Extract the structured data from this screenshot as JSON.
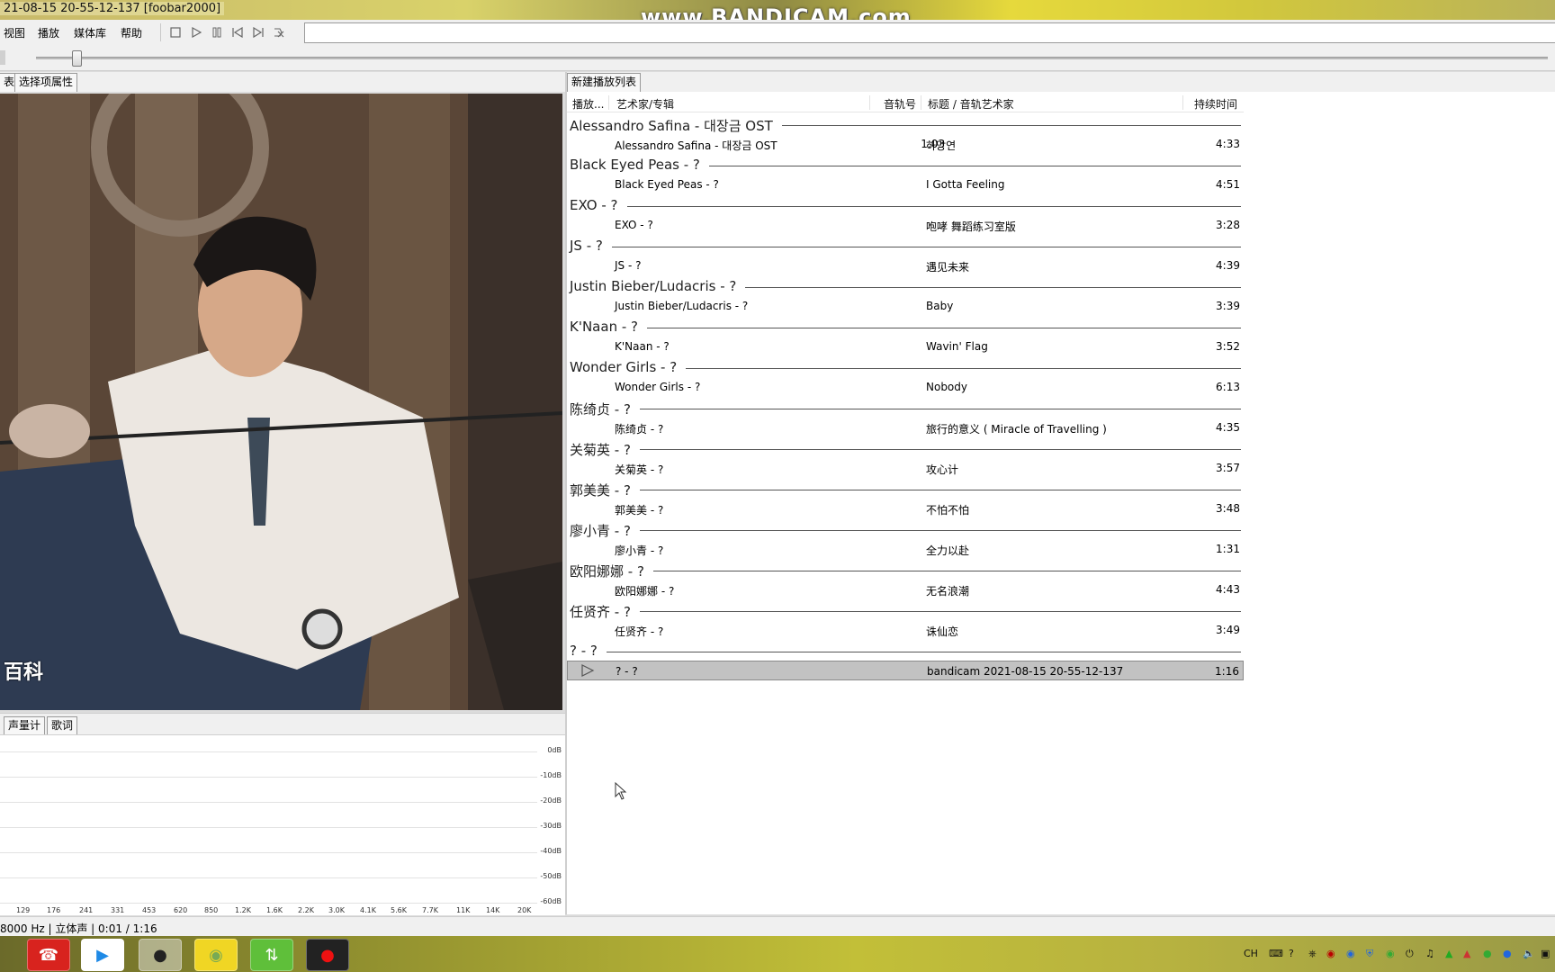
{
  "window": {
    "title": "21-08-15 20-55-12-137  [foobar2000]",
    "watermark": "www.BANDICAM.com"
  },
  "menu": [
    "视图",
    "播放",
    "媒体库",
    "帮助"
  ],
  "toolbar": {
    "icons": [
      "stop-icon",
      "play-icon",
      "pause-icon",
      "previous-icon",
      "next-icon",
      "random-icon"
    ]
  },
  "seek": {
    "position_fraction": 0.03
  },
  "left_panel": {
    "tabs": [
      "表",
      "选择项属性"
    ],
    "art_caption": "百科",
    "bottom_tabs": [
      "声量计",
      "歌词"
    ],
    "db_labels": [
      "0dB",
      "-10dB",
      "-20dB",
      "-30dB",
      "-40dB",
      "-50dB",
      "-60dB"
    ],
    "freq_labels": [
      "129",
      "176",
      "241",
      "331",
      "453",
      "620",
      "850",
      "1.2K",
      "1.6K",
      "2.2K",
      "3.0K",
      "4.1K",
      "5.6K",
      "7.7K",
      "11K",
      "14K",
      "20K"
    ]
  },
  "playlist": {
    "tab": "新建播放列表",
    "columns": {
      "playing": "播放...",
      "artist_album": "艺术家/专辑",
      "track_no": "音轨号",
      "title_artist": "标题 / 音轨艺术家",
      "duration": "持续时间"
    },
    "groups": [
      {
        "header": "Alessandro Safina - 대장금 OST",
        "track": {
          "artist": "Alessandro Safina - 대장금 OST",
          "no": "1.03",
          "title": "하망연",
          "duration": "4:33"
        }
      },
      {
        "header": "Black Eyed Peas - ?",
        "track": {
          "artist": "Black Eyed Peas - ?",
          "no": "",
          "title": "I Gotta Feeling",
          "duration": "4:51"
        }
      },
      {
        "header": "EXO - ?",
        "track": {
          "artist": "EXO - ?",
          "no": "",
          "title": "咆哮 舞蹈练习室版",
          "duration": "3:28"
        }
      },
      {
        "header": "JS - ?",
        "track": {
          "artist": "JS - ?",
          "no": "",
          "title": "遇见未来",
          "duration": "4:39"
        }
      },
      {
        "header": "Justin Bieber/Ludacris - ?",
        "track": {
          "artist": "Justin Bieber/Ludacris - ?",
          "no": "",
          "title": "Baby",
          "duration": "3:39"
        }
      },
      {
        "header": "K'Naan - ?",
        "track": {
          "artist": "K'Naan - ?",
          "no": "",
          "title": "Wavin' Flag",
          "duration": "3:52"
        }
      },
      {
        "header": "Wonder Girls - ?",
        "track": {
          "artist": "Wonder Girls - ?",
          "no": "",
          "title": "Nobody",
          "duration": "6:13"
        }
      },
      {
        "header": "陈绮贞 - ?",
        "track": {
          "artist": "陈绮贞 - ?",
          "no": "",
          "title": "旅行的意义 ( Miracle of Travelling )",
          "duration": "4:35"
        }
      },
      {
        "header": "关菊英 - ?",
        "track": {
          "artist": "关菊英 - ?",
          "no": "",
          "title": "攻心计",
          "duration": "3:57"
        }
      },
      {
        "header": "郭美美 - ?",
        "track": {
          "artist": "郭美美 - ?",
          "no": "",
          "title": "不怕不怕",
          "duration": "3:48"
        }
      },
      {
        "header": "廖小青 - ?",
        "track": {
          "artist": "廖小青 - ?",
          "no": "",
          "title": "全力以赴",
          "duration": "1:31"
        }
      },
      {
        "header": "欧阳娜娜 - ?",
        "track": {
          "artist": "欧阳娜娜 - ?",
          "no": "",
          "title": "无名浪潮",
          "duration": "4:43"
        }
      },
      {
        "header": "任贤齐 - ?",
        "track": {
          "artist": "任贤齐 - ?",
          "no": "",
          "title": "诛仙恋",
          "duration": "3:49"
        }
      },
      {
        "header": "? - ?",
        "track": {
          "artist": "? - ?",
          "no": "",
          "title": "bandicam 2021-08-15 20-55-12-137",
          "duration": "1:16",
          "playing": true
        }
      }
    ]
  },
  "status": "8000 Hz | 立体声 | 0:01 / 1:16",
  "taskbar": {
    "apps": [
      "netease-music-icon",
      "youku-icon",
      "foobar-icon",
      "green-ball-icon",
      "sync-icon",
      "bandicam-record-icon"
    ],
    "tray_lang": "CH"
  },
  "colors": {
    "selected_row": "#c2c2c2",
    "panel_bg": "#f0f0f0"
  }
}
